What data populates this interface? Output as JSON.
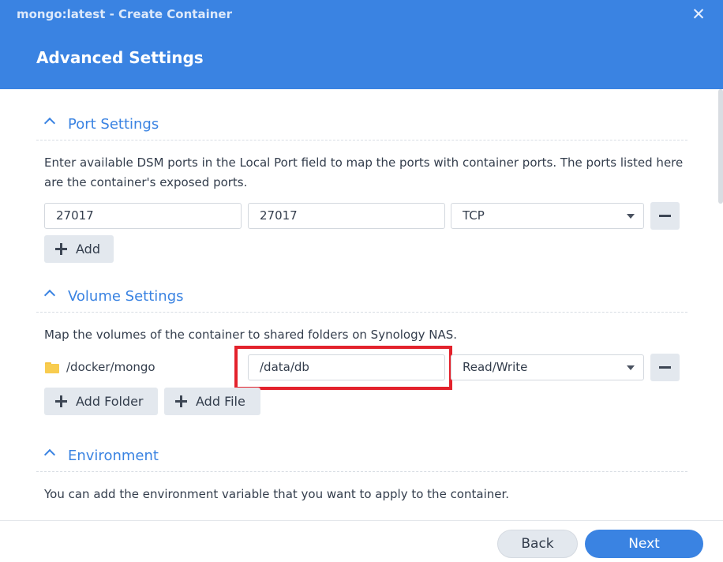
{
  "window": {
    "title": "mongo:latest - Create Container",
    "page_title": "Advanced Settings",
    "close_icon": "close-icon"
  },
  "port_settings": {
    "heading": "Port Settings",
    "description": "Enter available DSM ports in the Local Port field to map the ports with container ports. The ports listed here are the container's exposed ports.",
    "local_port": "27017",
    "container_port": "27017",
    "protocol": "TCP",
    "add_label": "Add"
  },
  "volume_settings": {
    "heading": "Volume Settings",
    "description": "Map the volumes of the container to shared folders on Synology NAS.",
    "folder": "/docker/mongo",
    "mount_path": "/data/db",
    "permission": "Read/Write",
    "add_folder_label": "Add Folder",
    "add_file_label": "Add File"
  },
  "environment": {
    "heading": "Environment",
    "description": "You can add the environment variable that you want to apply to the container."
  },
  "footer": {
    "back_label": "Back",
    "next_label": "Next"
  },
  "colors": {
    "accent": "#3a83e2",
    "highlight": "#e3222c",
    "folder": "#f8cc4f"
  }
}
